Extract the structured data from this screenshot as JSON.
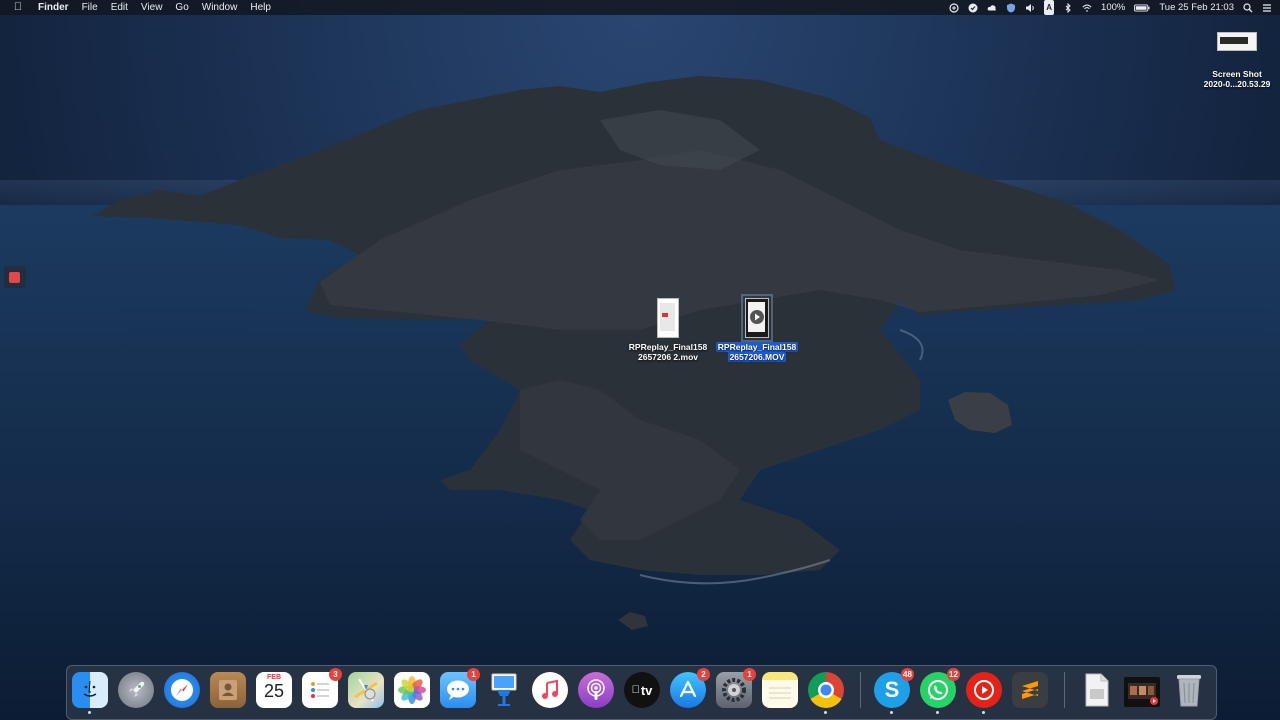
{
  "menubar": {
    "apple": "",
    "app_name": "Finder",
    "menus": [
      "File",
      "Edit",
      "View",
      "Go",
      "Window",
      "Help"
    ],
    "battery": "100%",
    "input_source": "A",
    "clock": "Tue 25 Feb  21:03"
  },
  "desktop": {
    "files": [
      {
        "line1": "RPReplay_Final158",
        "line2": "2657206 2.mov",
        "selected": false
      },
      {
        "line1": "RPReplay_Final158",
        "line2": "2657206.MOV",
        "selected": true
      }
    ],
    "screenshot": {
      "line1": "Screen Shot",
      "line2": "2020-0...20.53.29"
    }
  },
  "dock": {
    "calendar_month": "FEB",
    "calendar_day": "25",
    "appletv_label": "tv",
    "badges": {
      "reminders": "3",
      "messages": "1",
      "appstore": "2",
      "system_prefs": "1",
      "skype": "48",
      "whatsapp": "12"
    }
  }
}
